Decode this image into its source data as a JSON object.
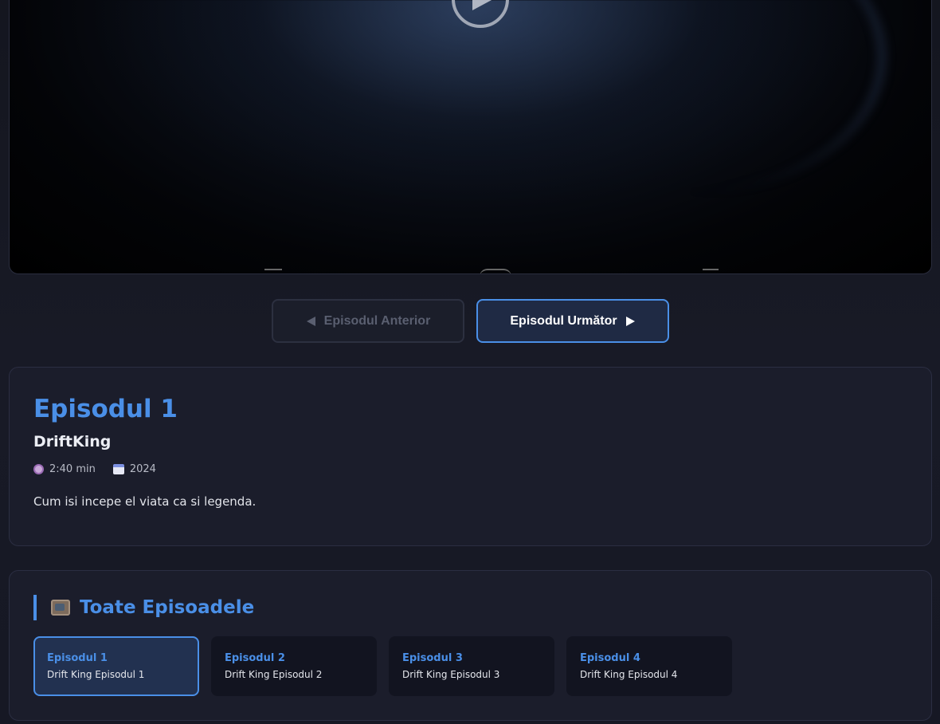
{
  "player": {
    "play_icon": "play-icon"
  },
  "nav": {
    "prev_label": "Episodul Anterior",
    "next_label": "Episodul Următor"
  },
  "episode": {
    "title": "Episodul 1",
    "show": "DriftKing",
    "duration": "2:40 min",
    "year": "2024",
    "description": "Cum isi incepe el viata ca si legenda."
  },
  "all_episodes": {
    "heading": "Toate Episoadele",
    "items": [
      {
        "num": "Episodul 1",
        "name": "Drift King Episodul 1",
        "active": true
      },
      {
        "num": "Episodul 2",
        "name": "Drift King Episodul 2",
        "active": false
      },
      {
        "num": "Episodul 3",
        "name": "Drift King Episodul 3",
        "active": false
      },
      {
        "num": "Episodul 4",
        "name": "Drift King Episodul 4",
        "active": false
      }
    ]
  },
  "colors": {
    "accent": "#4a8fe7",
    "card_bg": "#1b1d2b",
    "page_bg": "#161824"
  }
}
